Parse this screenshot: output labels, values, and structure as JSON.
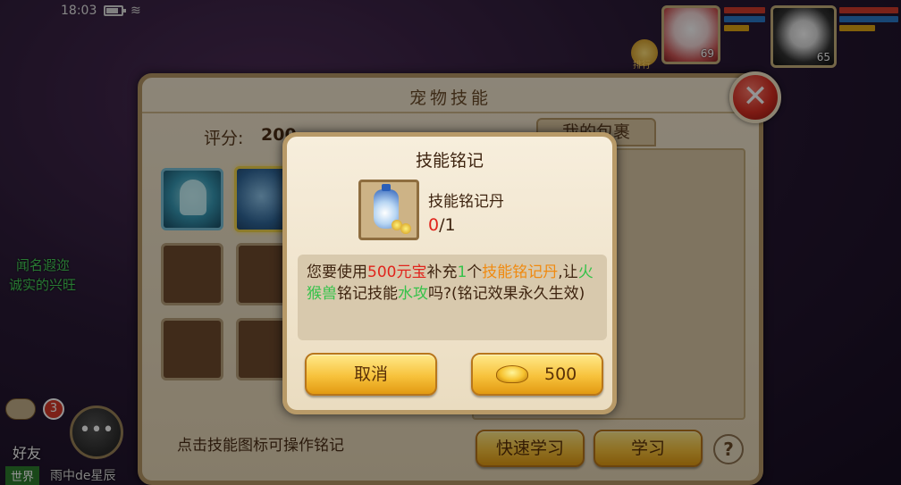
{
  "status_bar": {
    "time": "18:03"
  },
  "hud": {
    "pet1_level": "69",
    "pet2_level": "65",
    "crown_label": "排行"
  },
  "chat": {
    "line1": "闻名遐迩",
    "line2": "诚实的兴旺",
    "friend_count": "3",
    "friend_label": "好友",
    "world_tag": "世界",
    "world_msg": "雨中de星辰"
  },
  "panel": {
    "title": "宠物技能",
    "score_label": "评分:",
    "score_value": "200",
    "bag_tab": "我的包裹",
    "hint": "点击技能图标可操作铭记",
    "quick_learn": "快速学习",
    "learn": "学习",
    "help": "?"
  },
  "dialog": {
    "title": "技能铭记",
    "item_name": "技能铭记丹",
    "item_have": "0",
    "item_need": "/1",
    "msg": {
      "p1": "您要使用",
      "cost": "500元宝",
      "p2": "补充",
      "qty": "1",
      "p3": "个",
      "item": "技能铭记丹",
      "p4": ",让",
      "pet": "火猴兽",
      "p5": "铭记技能",
      "skill": "水攻",
      "p6": "吗?(铭记效果永久生效)"
    },
    "cancel_label": "取消",
    "confirm_value": "500"
  },
  "colors": {
    "accent_gold": "#f7c23c",
    "highlight_red": "#e0241c",
    "highlight_green": "#35c24a",
    "highlight_orange": "#f08a10"
  }
}
